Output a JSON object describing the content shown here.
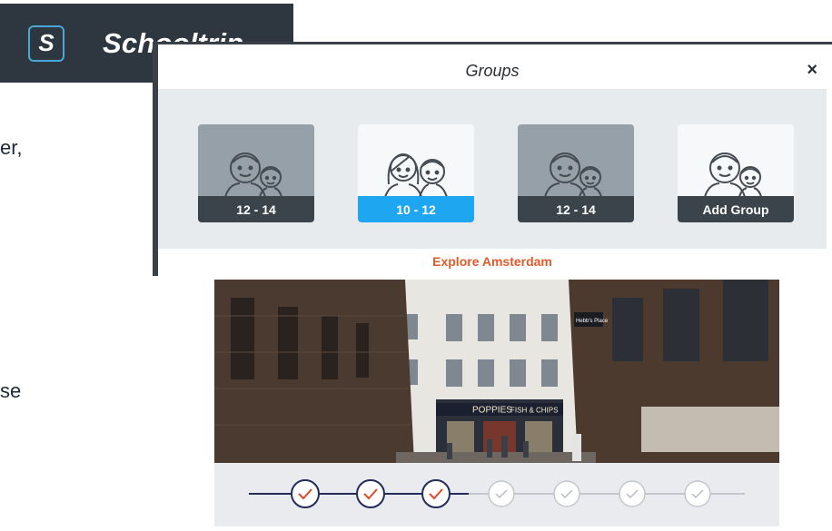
{
  "brand": {
    "logo_letter": "S",
    "name": "Schooltrip"
  },
  "side_text": {
    "line1": "er,",
    "line2": "se"
  },
  "modal": {
    "title": "Groups",
    "close_glyph": "×",
    "groups": [
      {
        "label": "12 - 14",
        "style": "dark"
      },
      {
        "label": "10 - 12",
        "style": "selected"
      },
      {
        "label": "12 - 14",
        "style": "dark"
      },
      {
        "label": "Add Group",
        "style": "add"
      }
    ],
    "footer_title": "Explore Amsterdam"
  },
  "photo": {
    "shop_sign": "POPPIES",
    "shop_sign_2": "FISH & CHIPS",
    "street_sign": "Hebb's Place"
  },
  "progress": {
    "steps_done": 3,
    "steps_total": 7
  },
  "colors": {
    "brand_bg": "#2e3640",
    "selected_blue": "#1ea7f0",
    "accent_orange": "#e15a2b",
    "check_red": "#e0472a",
    "track_navy": "#232c5a"
  }
}
